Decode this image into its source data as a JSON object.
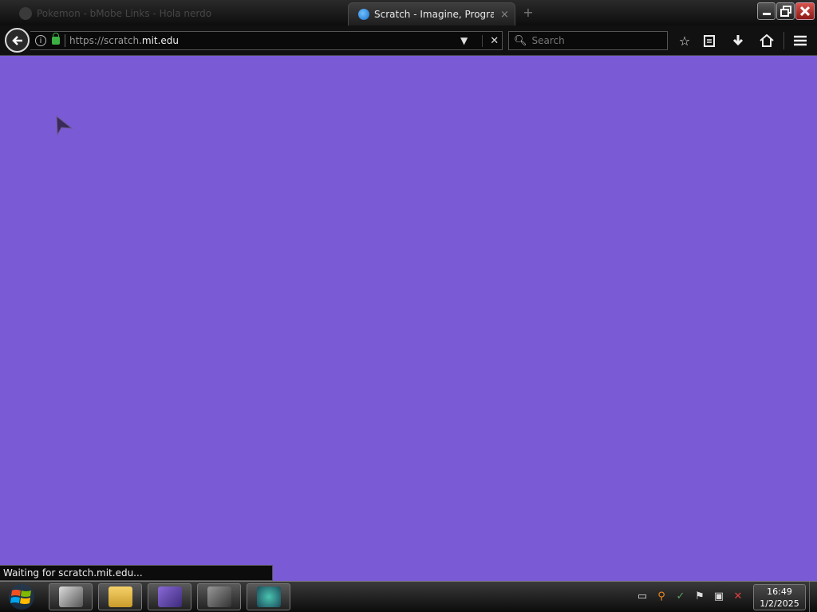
{
  "browser": {
    "tabs": [
      {
        "label": "Pokemon - bMobe Links - Hola nerdo",
        "active": false
      },
      {
        "label": "Scratch - Imagine, Program, Share",
        "active": true
      }
    ],
    "new_tab_symbol": "+",
    "tab_close_symbol": "×",
    "url_prefix": "https://scratch.",
    "url_host": "mit.edu",
    "search_placeholder": "Search",
    "status_text": "Waiting for scratch.mit.edu..."
  },
  "page": {
    "background_color": "#7b5ad6"
  },
  "taskbar": {
    "time": "16:49",
    "date": "1/2/2025"
  }
}
